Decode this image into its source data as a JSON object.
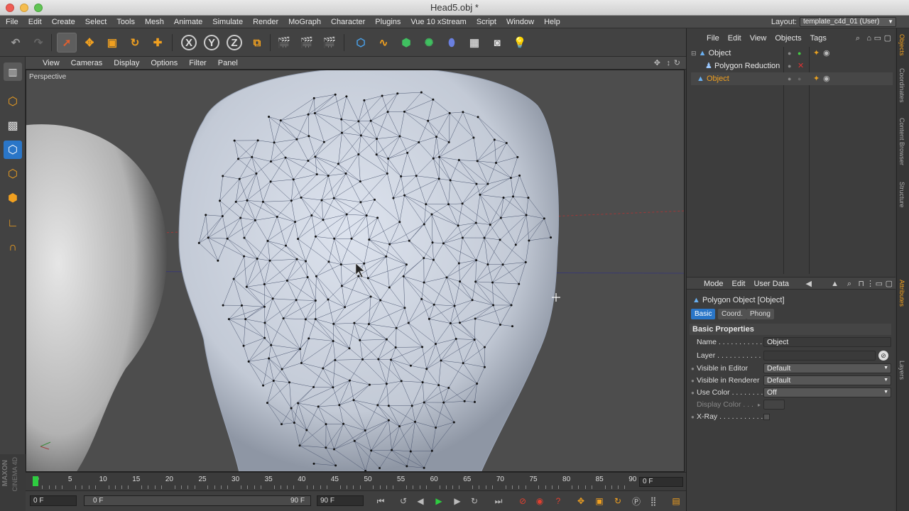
{
  "window": {
    "title": "Head5.obj *"
  },
  "menubar": {
    "items": [
      "File",
      "Edit",
      "Create",
      "Select",
      "Tools",
      "Mesh",
      "Animate",
      "Simulate",
      "Render",
      "MoGraph",
      "Character",
      "Plugins",
      "Vue 10 xStream",
      "Script",
      "Window",
      "Help"
    ],
    "layout_label": "Layout:",
    "layout_value": "template_c4d_01 (User)"
  },
  "toolbar": {
    "axis_x": "X",
    "axis_y": "Y",
    "axis_z": "Z"
  },
  "viewport": {
    "menu": [
      "View",
      "Cameras",
      "Display",
      "Options",
      "Filter",
      "Panel"
    ],
    "label": "Perspective"
  },
  "object_manager": {
    "menu": [
      "File",
      "Edit",
      "View",
      "Objects",
      "Tags"
    ],
    "objects": [
      {
        "name": "Object"
      },
      {
        "name": "Polygon Reduction"
      },
      {
        "name": "Object"
      }
    ]
  },
  "attributes": {
    "menu": [
      "Mode",
      "Edit",
      "User Data"
    ],
    "header": "Polygon Object [Object]",
    "tabs": [
      "Basic",
      "Coord.",
      "Phong"
    ],
    "section": "Basic Properties",
    "props": [
      {
        "label": "Name . . . . . . . . . . . .",
        "value": "Object"
      },
      {
        "label": "Layer . . . . . . . . . . . .",
        "value": ""
      },
      {
        "label": "Visible in Editor",
        "value": "Default"
      },
      {
        "label": "Visible in Renderer",
        "value": "Default"
      },
      {
        "label": "Use Color . . . . . . . .",
        "value": "Off"
      },
      {
        "label": "Display Color . . .",
        "value": ""
      },
      {
        "label": "X-Ray . . . . . . . . . . . .",
        "value": ""
      }
    ]
  },
  "side_tabs": [
    "Objects",
    "Coordinates",
    "Content Browser",
    "Structure",
    "Attributes",
    "Layers"
  ],
  "timeline": {
    "ticks": [
      "0",
      "5",
      "10",
      "15",
      "20",
      "25",
      "30",
      "35",
      "40",
      "45",
      "50",
      "55",
      "60",
      "65",
      "70",
      "75",
      "80",
      "85",
      "90"
    ],
    "current_frame": "0 F"
  },
  "playback": {
    "start_field": "0 F",
    "range_start": "0 F",
    "range_end": "90 F",
    "end_field": "90 F"
  },
  "branding": {
    "line1": "MAXON",
    "line2": "CINEMA 4D"
  },
  "colors": {
    "accent_orange": "#e8a020",
    "selection_blue": "#2a76c8",
    "play_green": "#2ecc40"
  }
}
